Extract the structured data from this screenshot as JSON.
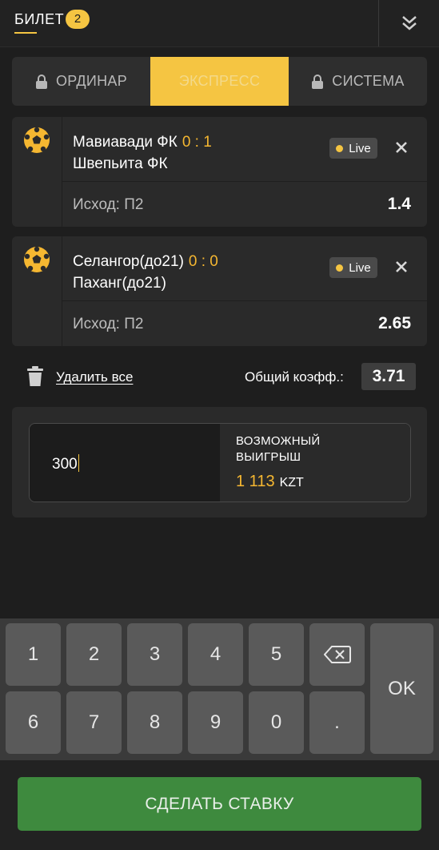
{
  "header": {
    "title": "БИЛЕТ",
    "count": "2"
  },
  "tabs": [
    {
      "label": "ОРДИНАР",
      "icon": "lock-icon",
      "active": false
    },
    {
      "label": "ЭКСПРЕСС",
      "active": true
    },
    {
      "label": "СИСТЕМА",
      "icon": "lock-icon",
      "active": false
    }
  ],
  "bets": [
    {
      "team1": "Мавиавади ФК",
      "score": "0 : 1",
      "team2": "Швепьита ФК",
      "live": "Live",
      "outcome": "Исход: П2",
      "odd": "1.4"
    },
    {
      "team1": "Селангор(до21)",
      "score": "0 : 0",
      "team2": "Паханг(до21)",
      "live": "Live",
      "outcome": "Исход: П2",
      "odd": "2.65"
    }
  ],
  "actions": {
    "delete_all": "Удалить все",
    "total_label": "Общий коэфф.:",
    "total_value": "3.71"
  },
  "stake": {
    "value": "300",
    "win_label": "ВОЗМОЖНЫЙ ВЫИГРЫШ",
    "win_amount": "1 113",
    "currency": "KZT"
  },
  "keyboard": {
    "row1": [
      "1",
      "2",
      "3",
      "4",
      "5"
    ],
    "row2": [
      "6",
      "7",
      "8",
      "9",
      "0",
      "."
    ],
    "ok": "OK"
  },
  "submit": {
    "label": "СДЕЛАТЬ СТАВКУ"
  },
  "colors": {
    "accent": "#f5c542",
    "score": "#f5b731",
    "submit": "#3e8a3e",
    "background": "#1e1e1e"
  }
}
